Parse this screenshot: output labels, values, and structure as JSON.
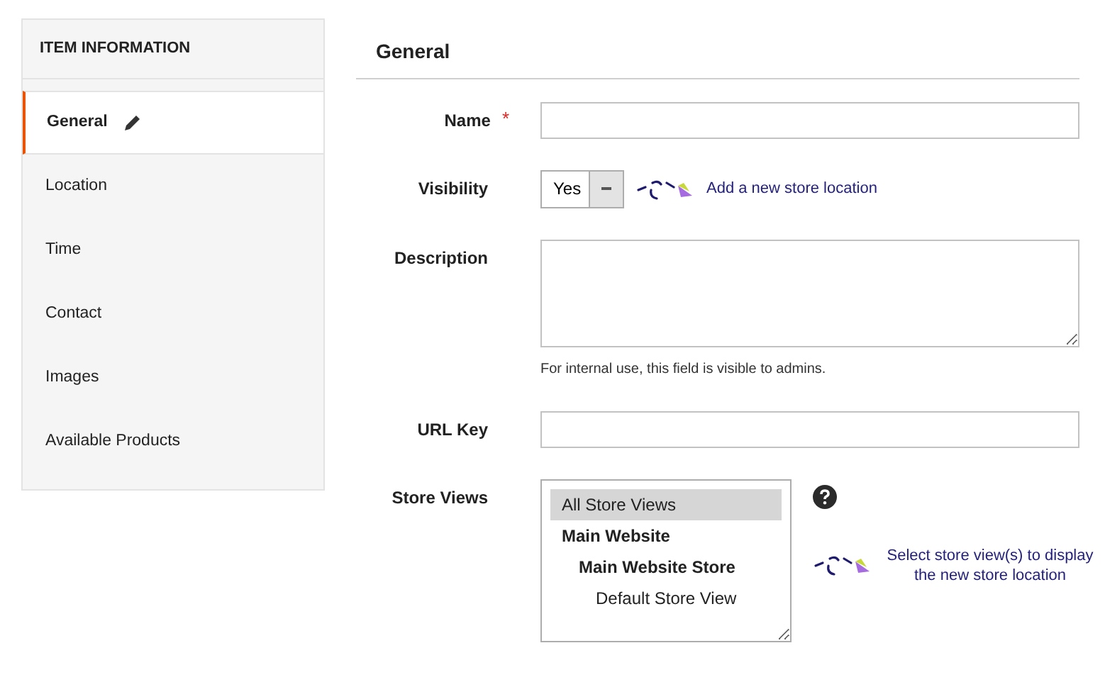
{
  "sidebar": {
    "title": "ITEM INFORMATION",
    "items": [
      {
        "label": "General",
        "selected": true,
        "editing": true
      },
      {
        "label": "Location",
        "selected": false,
        "editing": false
      },
      {
        "label": "Time",
        "selected": false,
        "editing": false
      },
      {
        "label": "Contact",
        "selected": false,
        "editing": false
      },
      {
        "label": "Images",
        "selected": false,
        "editing": false
      },
      {
        "label": "Available Products",
        "selected": false,
        "editing": false
      }
    ]
  },
  "section": {
    "title": "General"
  },
  "fields": [
    {
      "kind": "text",
      "label": "Name",
      "required_mark": "*"
    },
    {
      "kind": "select",
      "label": "Visibility",
      "value": "Yes",
      "annotation": "Add a new store location"
    },
    {
      "kind": "textarea",
      "label": "Description",
      "note": "For internal use, this field is visible to admins."
    },
    {
      "kind": "text",
      "label": "URL Key"
    },
    {
      "kind": "multiselect",
      "label": "Store Views",
      "help": true,
      "annotation": "Select store view(s) to display the new store location",
      "options": [
        {
          "kind": "all",
          "label": "All Store Views",
          "selected": true
        },
        {
          "kind": "website",
          "label": "Main Website",
          "selected": false
        },
        {
          "kind": "store",
          "label": "Main Website Store",
          "selected": false
        },
        {
          "kind": "view",
          "label": "Default Store View",
          "selected": false
        }
      ]
    }
  ]
}
